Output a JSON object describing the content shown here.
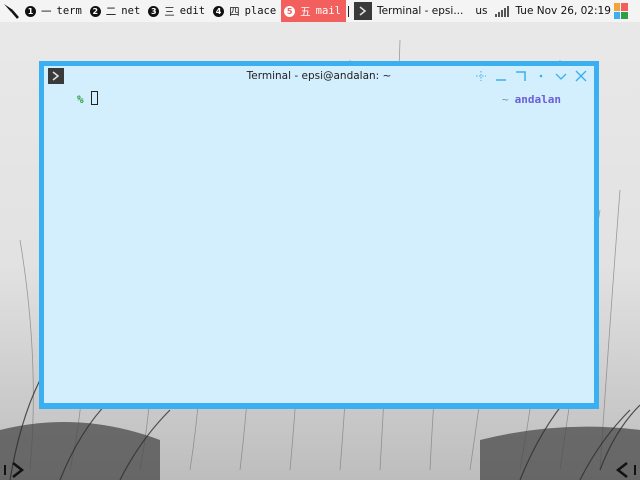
{
  "top_panel": {
    "workspaces": [
      {
        "num": "1",
        "glyph": "一",
        "label": "term",
        "active": false
      },
      {
        "num": "2",
        "glyph": "二",
        "label": "net",
        "active": false
      },
      {
        "num": "3",
        "glyph": "三",
        "label": "edit",
        "active": false
      },
      {
        "num": "4",
        "glyph": "四",
        "label": "place",
        "active": false
      },
      {
        "num": "5",
        "glyph": "五",
        "label": "mail",
        "active": true
      }
    ],
    "active_color": "#f25f5c",
    "task_label": "Terminal - epsi...",
    "keyboard_layout": "us",
    "clock": "Tue Nov 26, 02:19",
    "menu_colors": [
      "#f2a33a",
      "#f25f5c",
      "#3ab0f2",
      "#2ea043"
    ]
  },
  "terminal": {
    "title": "Terminal - epsi@andalan: ~",
    "border_color": "#3ab0f2",
    "prompt": "%",
    "right_prompt_tilde": "~",
    "right_prompt_host": "andalan",
    "buttons": [
      "move-icon",
      "minimize-icon",
      "maximize-icon",
      "stick-icon",
      "shade-icon",
      "close-icon"
    ]
  }
}
